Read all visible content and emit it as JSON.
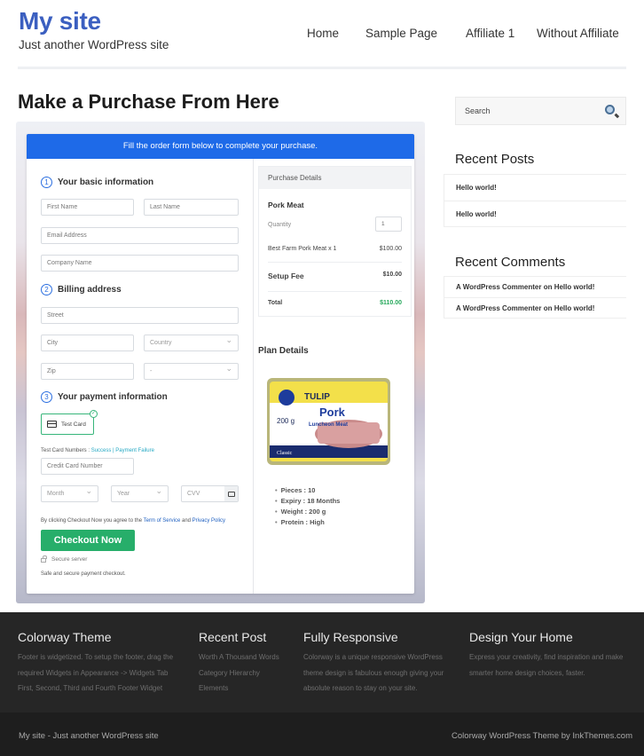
{
  "site": {
    "title": "My site",
    "tagline": "Just another WordPress site",
    "brand_color": "#3b5fc0"
  },
  "nav": {
    "items": [
      "Home",
      "Sample Page",
      "Affiliate 1",
      "Without Affiliate"
    ]
  },
  "page": {
    "title": "Make a Purchase From Here"
  },
  "checkout": {
    "banner": "Fill the order form below to complete your purchase.",
    "banner_color": "#1e6ae8",
    "sections": [
      {
        "num": "1",
        "title": "Your basic information"
      },
      {
        "num": "2",
        "title": "Billing address"
      },
      {
        "num": "3",
        "title": "Your payment information"
      }
    ],
    "fields": {
      "first_name": "First Name",
      "last_name": "Last Name",
      "email": "Email Address",
      "company": "Company Name",
      "street": "Street",
      "city": "City",
      "country": "Country",
      "zip": "Zip",
      "state": "-",
      "card_number": "Credit Card Number",
      "month": "Month",
      "year": "Year",
      "cvv": "CVV"
    },
    "payment_option": "Test Card",
    "test_cards": {
      "label": "Test Card Numbers : ",
      "success": "Success",
      "separator": " | ",
      "failure": "Payment Failure"
    },
    "agreement": {
      "prefix": "By clicking Checkout Now you agree to the ",
      "terms": "Term of Service",
      "and": " and ",
      "privacy": "Privacy Policy"
    },
    "checkout_button": "Checkout Now",
    "checkout_color": "#27ae6a",
    "secure_server": "Secure server",
    "safe_text": "Safe and secure payment checkout."
  },
  "purchase_details": {
    "header": "Purchase Details",
    "product": "Pork Meat",
    "quantity_label": "Quantity",
    "quantity_value": "1",
    "line_item": "Best Farm Pork Meat x 1",
    "line_amount": "$100.00",
    "setup_fee_label": "Setup Fee",
    "setup_fee_amount": "$10.00",
    "total_label": "Total",
    "total_amount": "$110.00",
    "total_color": "#25a85a"
  },
  "plan": {
    "title": "Plan Details",
    "image_label": "Pork Luncheon Meat can",
    "image_texts": {
      "brand": "TULIP",
      "name": "Pork",
      "sub": "Luncheon Meat",
      "weight": "200 g",
      "variant": "Classic"
    },
    "features": [
      "Pieces : 10",
      "Expiry : 18 Months",
      "Weight : 200 g",
      "Protein : High"
    ]
  },
  "sidebar": {
    "search_placeholder": "Search",
    "recent_posts_title": "Recent Posts",
    "recent_posts": [
      "Hello world!",
      "Hello world!"
    ],
    "recent_comments_title": "Recent Comments",
    "recent_comments": [
      "A WordPress Commenter on Hello world!",
      "A WordPress Commenter on Hello world!"
    ]
  },
  "footer": {
    "columns": [
      {
        "title": "Colorway Theme",
        "lines": [
          "Footer is widgetized. To setup the footer, drag the",
          "required Widgets in Appearance -> Widgets Tab",
          "First, Second, Third and Fourth Footer Widget"
        ]
      },
      {
        "title": "Recent Post",
        "lines": [
          "Worth A Thousand Words",
          "Category Hierarchy",
          "Elements"
        ]
      },
      {
        "title": "Fully Responsive",
        "lines": [
          "Colorway is a unique responsive WordPress",
          "theme design is fabulous enough giving your",
          "absolute reason to stay on your site."
        ]
      },
      {
        "title": "Design Your Home",
        "lines": [
          "Express your creativity, find inspiration and make",
          "smarter home design choices, faster."
        ]
      }
    ],
    "bottom_left": "My site - Just another WordPress site",
    "bottom_right": "Colorway WordPress Theme by InkThemes.com"
  }
}
